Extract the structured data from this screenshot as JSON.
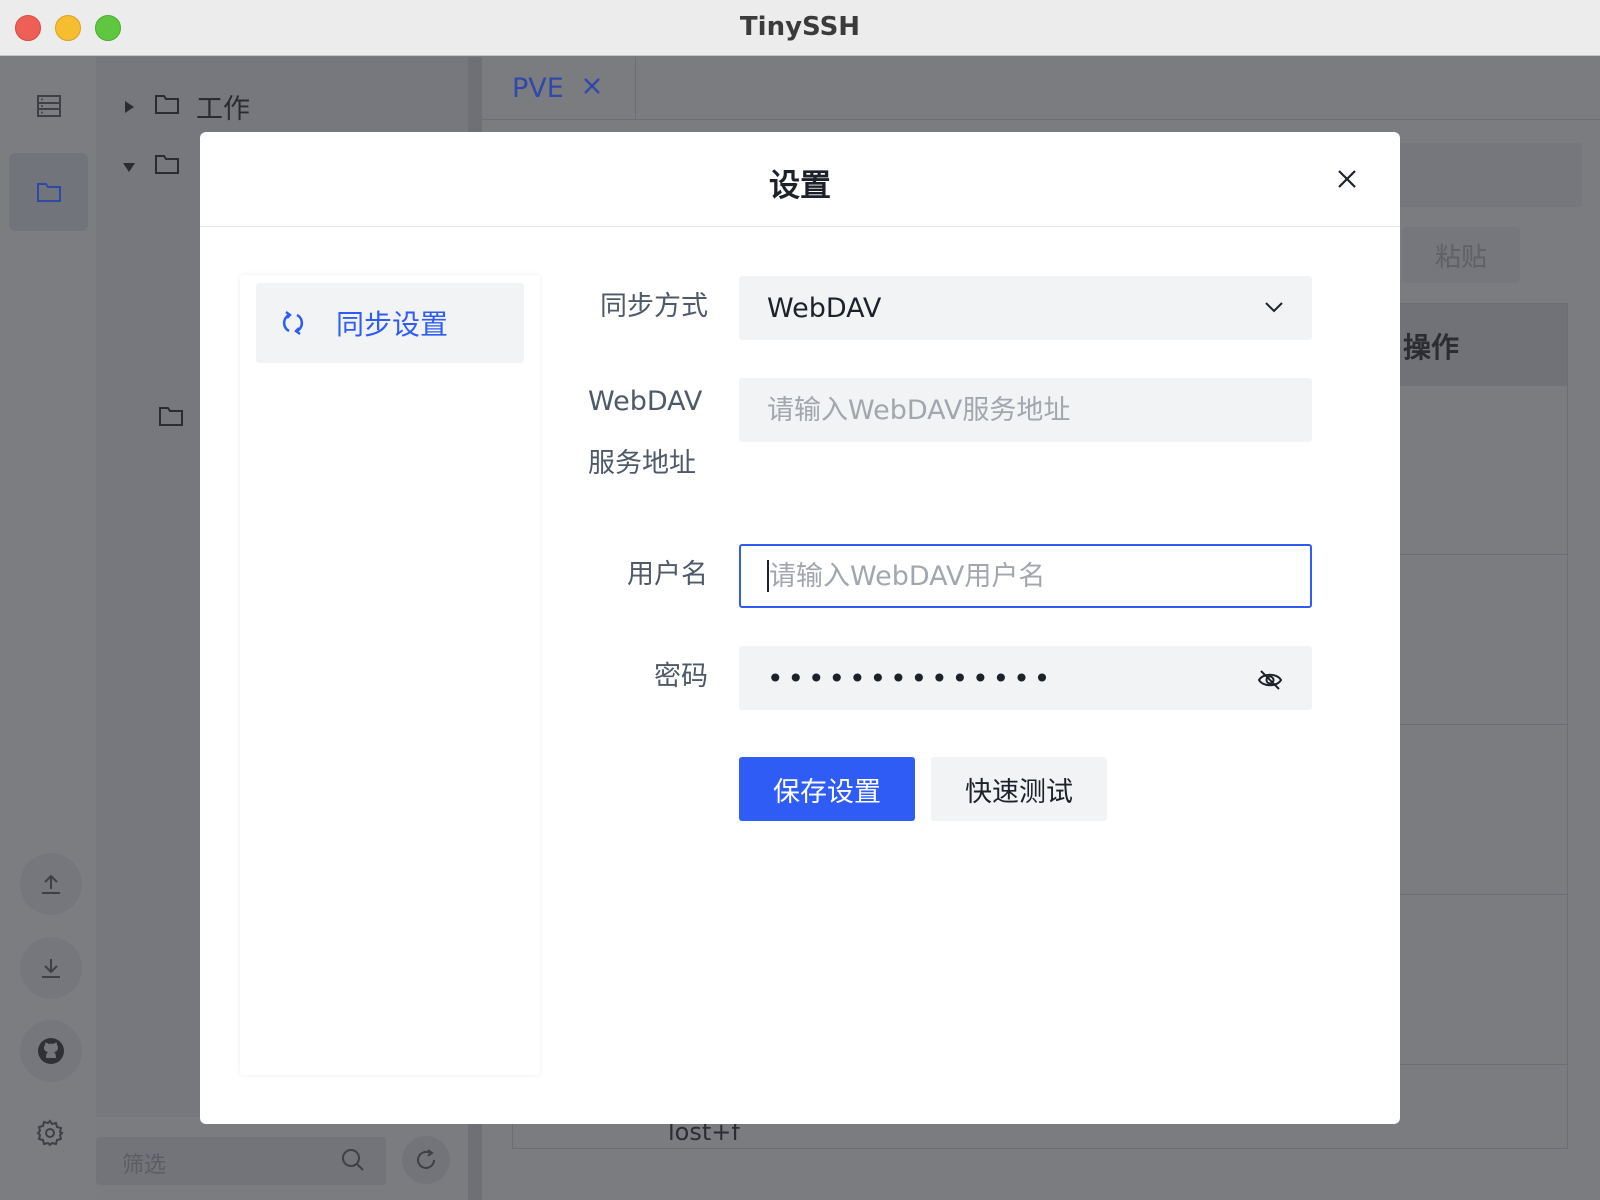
{
  "window": {
    "title": "TinySSH"
  },
  "background": {
    "tree": [
      {
        "label": "工作",
        "expanded": false
      },
      {
        "label": "",
        "expanded": true
      },
      {
        "label": ""
      }
    ],
    "tab": {
      "label": "PVE"
    },
    "paste_label": "粘贴",
    "table_header_action": "操作",
    "filter_placeholder": "筛选",
    "partial_row": "lost+f"
  },
  "modal": {
    "title": "设置",
    "nav": [
      {
        "label": "同步设置",
        "icon": "sync-icon",
        "active": true
      }
    ],
    "form": {
      "sync_method": {
        "label": "同步方式",
        "value": "WebDAV"
      },
      "url": {
        "label_line1": "WebDAV",
        "label_line2": "服务地址",
        "placeholder": "请输入WebDAV服务地址",
        "value": ""
      },
      "username": {
        "label": "用户名",
        "placeholder": "请输入WebDAV用户名",
        "value": ""
      },
      "password": {
        "label": "密码",
        "masked": "••••••••••••••"
      }
    },
    "buttons": {
      "save": "保存设置",
      "test": "快速测试"
    }
  },
  "colors": {
    "accent": "#2f5cf4",
    "field_bg": "#f2f3f5"
  }
}
